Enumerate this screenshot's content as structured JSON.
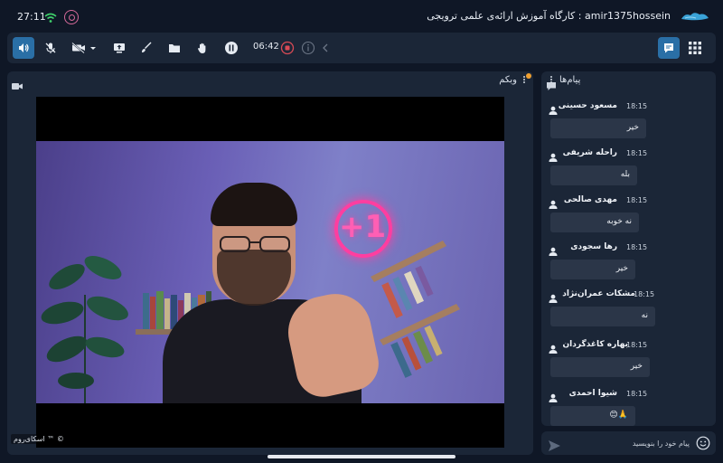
{
  "status": {
    "time": "27:11"
  },
  "header": {
    "title": "amir1375hossein : کارگاه آموزش ارائه‌ی علمی ترویجی"
  },
  "toolbar": {
    "timer": "06:42"
  },
  "webcam": {
    "title": "وبکم",
    "watermark": "اسکای‌روم ™ ©"
  },
  "chat": {
    "title": "پیام‌ها",
    "messages": [
      {
        "name": "مسعود حسینی",
        "time": "18:15",
        "text": "خیر",
        "w": 0
      },
      {
        "name": "راحله شریفی",
        "time": "18:15",
        "text": "بله"
      },
      {
        "name": "مهدی صالحی",
        "time": "18:15",
        "text": "نه خوبه"
      },
      {
        "name": "رها سجودی",
        "time": "18:15",
        "text": "خیر"
      },
      {
        "name": "مشکات عمران‌نژاد",
        "time": "18:15",
        "text": "نه"
      },
      {
        "name": "بهاره کاغذگردان",
        "time": "18:15",
        "text": "خیر"
      },
      {
        "name": "شیوا احمدی",
        "time": "18:15",
        "text": "🙏😊"
      }
    ],
    "input_placeholder": "پیام خود را بنویسید"
  },
  "colors": {
    "accent": "#2a6fa6",
    "panel": "#1b2637",
    "background": "#0f1726",
    "neon": "#ff3ea0"
  }
}
